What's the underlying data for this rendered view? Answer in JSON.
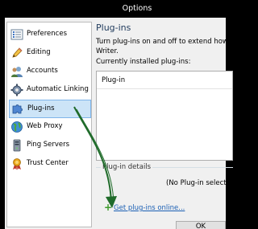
{
  "window": {
    "title": "Options"
  },
  "sidebar": {
    "items": [
      {
        "label": "Preferences",
        "icon": "preferences-icon"
      },
      {
        "label": "Editing",
        "icon": "pencil-icon"
      },
      {
        "label": "Accounts",
        "icon": "accounts-icon"
      },
      {
        "label": "Automatic Linking",
        "icon": "automatic-linking-icon"
      },
      {
        "label": "Plug-ins",
        "icon": "puzzle-icon",
        "selected": true
      },
      {
        "label": "Web Proxy",
        "icon": "globe-icon"
      },
      {
        "label": "Ping Servers",
        "icon": "ping-servers-icon"
      },
      {
        "label": "Trust Center",
        "icon": "ribbon-icon"
      }
    ]
  },
  "main": {
    "heading": "Plug-ins",
    "description_line1": "Turn plug-ins on and off to extend how you",
    "description_line2": "Writer.",
    "installed_label": "Currently installed plug-ins:",
    "list_column_header": "Plug-in",
    "details_legend": "Plug-in details",
    "no_selection_text": "(No Plug-in selecte",
    "get_online_link": "Get plug-ins online..."
  },
  "footer": {
    "ok_label": "OK"
  },
  "colors": {
    "selection_bg": "#cce4f7",
    "selection_border": "#7eb4ea",
    "link": "#1a5fb4",
    "annotation_arrow": "#1f6b2a",
    "plus_icon": "#3c9a2a"
  }
}
